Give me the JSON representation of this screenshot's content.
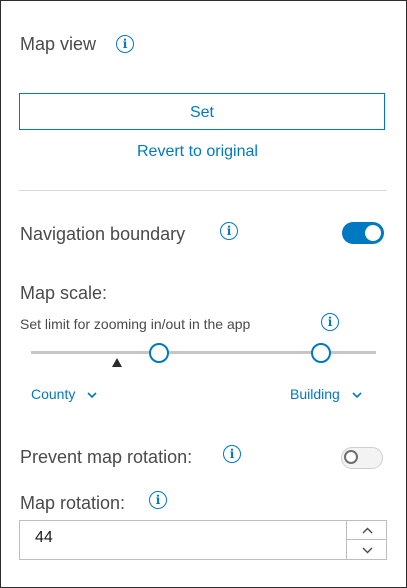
{
  "map_view": {
    "label": "Map view",
    "info_icon": "i",
    "set_button_label": "Set",
    "revert_link": "Revert to original"
  },
  "navigation_boundary": {
    "label": "Navigation boundary",
    "info_icon": "i",
    "enabled": true
  },
  "map_scale": {
    "label": "Map scale:",
    "description": "Set limit for zooming in/out in the app",
    "info_icon": "i",
    "slider_min_fraction": 0.37,
    "slider_max_fraction": 0.84,
    "current_marker_fraction": 0.25,
    "min_select_value": "County",
    "max_select_value": "Building"
  },
  "prevent_rotation": {
    "label": "Prevent map rotation:",
    "info_icon": "i",
    "enabled": false
  },
  "map_rotation": {
    "label": "Map rotation:",
    "info_icon": "i",
    "value": "44"
  },
  "colors": {
    "accent": "#0079c1",
    "text": "#4a4a4a",
    "divider": "#d9d9d9"
  }
}
